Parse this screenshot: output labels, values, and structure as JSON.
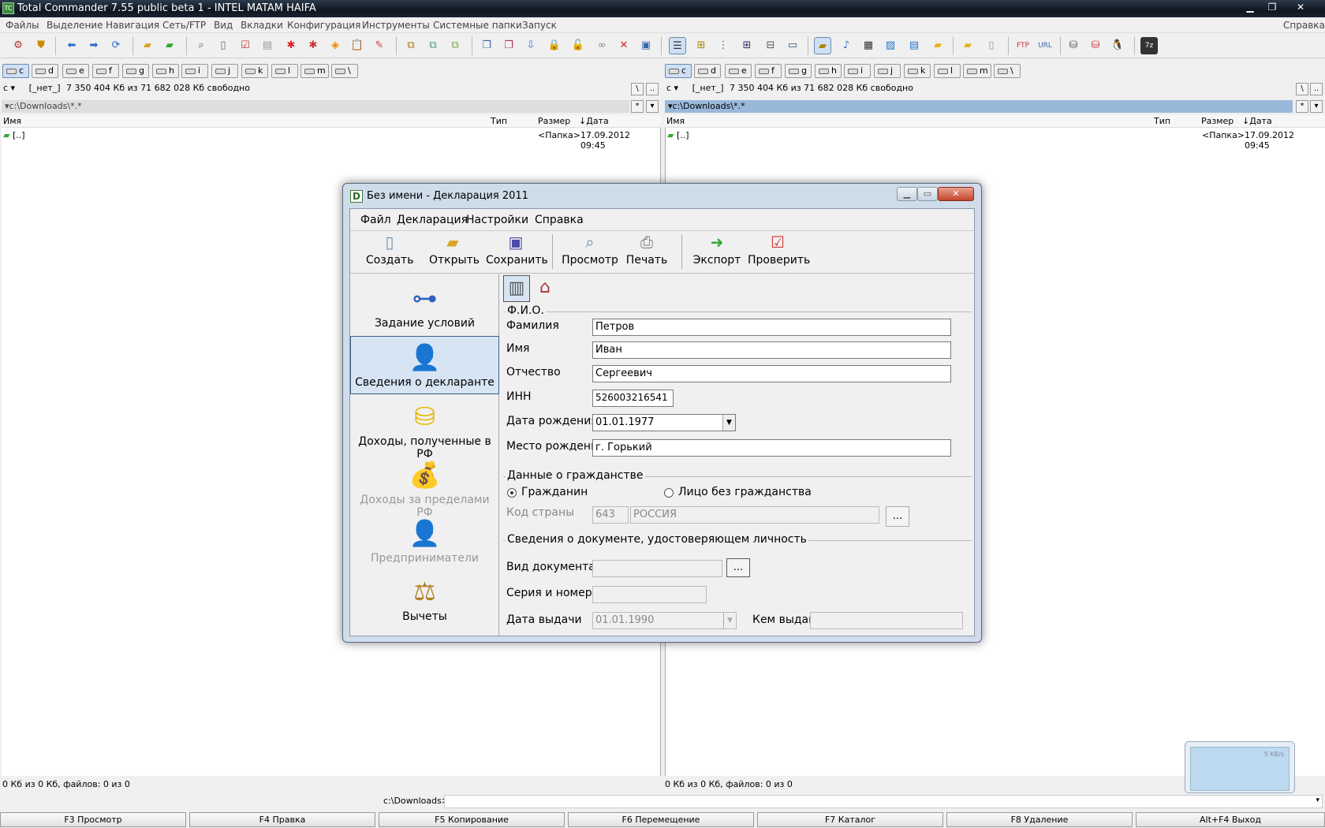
{
  "tc": {
    "title": "Total Commander 7.55 public beta 1 - INTEL MATAM HAIFA",
    "menu": [
      "Файлы",
      "Выделение",
      "Навигация",
      "Сеть/FTP",
      "Вид",
      "Вкладки",
      "Конфигурация",
      "Инструменты",
      "Системные папки",
      "Запуск"
    ],
    "menu_help": "Справка",
    "drives": [
      "c",
      "d",
      "e",
      "f",
      "g",
      "h",
      "i",
      "j",
      "k",
      "l",
      "m",
      "\\"
    ],
    "left": {
      "drive": "c",
      "volume": "[_нет_]",
      "free": "7 350 404 Кб из 71 682 028 Кб свободно",
      "path": "c:\\Downloads\\*.*",
      "cols": {
        "name": "Имя",
        "type": "Тип",
        "size": "Размер",
        "date": "Дата"
      },
      "rows": [
        {
          "name": "[..]",
          "size": "<Папка>",
          "date": "17.09.2012 09:45"
        }
      ],
      "status": "0 Кб из 0 Кб, файлов: 0 из 0"
    },
    "right": {
      "drive": "c",
      "volume": "[_нет_]",
      "free": "7 350 404 Кб из 71 682 028 Кб свободно",
      "path": "c:\\Downloads\\*.*",
      "cols": {
        "name": "Имя",
        "type": "Тип",
        "size": "Размер",
        "date": "Дата"
      },
      "rows": [
        {
          "name": "[..]",
          "size": "<Папка>",
          "date": "17.09.2012 09:45"
        }
      ],
      "status": "0 Кб из 0 Кб, файлов: 0 из 0"
    },
    "cmd_path": "c:\\Downloads>",
    "fkeys": [
      "F3 Просмотр",
      "F4 Правка",
      "F5 Копирование",
      "F6 Перемещение",
      "F7 Каталог",
      "F8 Удаление",
      "Alt+F4 Выход"
    ],
    "up_label": "..",
    "root_label": "\\",
    "star_label": "*",
    "tray_rate": "5 KB/s"
  },
  "dlg": {
    "title": "Без имени - Декларация 2011",
    "menu": [
      "Файл",
      "Декларация",
      "Настройки",
      "Справка"
    ],
    "tools": [
      "Создать",
      "Открыть",
      "Сохранить",
      "Просмотр",
      "Печать",
      "Экспорт",
      "Проверить"
    ],
    "nav": [
      "Задание условий",
      "Сведения о декларанте",
      "Доходы, полученные в РФ",
      "Доходы за пределами РФ",
      "Предприниматели",
      "Вычеты"
    ],
    "fio": {
      "group": "Ф.И.О.",
      "surname_lbl": "Фамилия",
      "surname": "Петров",
      "name_lbl": "Имя",
      "name": "Иван",
      "patr_lbl": "Отчество",
      "patr": "Сергеевич",
      "inn_lbl": "ИНН",
      "inn": "526003216541",
      "dob_lbl": "Дата рождения",
      "dob": "01.01.1977",
      "pob_lbl": "Место рождения",
      "pob": "г. Горький"
    },
    "cit": {
      "group": "Данные о гражданстве",
      "opt1": "Гражданин",
      "opt2": "Лицо без гражданства",
      "code_lbl": "Код страны",
      "code": "643",
      "country": "РОССИЯ",
      "browse": "..."
    },
    "doc": {
      "group": "Сведения о документе, удостоверяющем личность",
      "type_lbl": "Вид документа",
      "browse": "...",
      "series_lbl": "Серия и номер",
      "issued_lbl": "Дата выдачи",
      "issued": "01.01.1990",
      "by_lbl": "Кем выдан"
    }
  }
}
